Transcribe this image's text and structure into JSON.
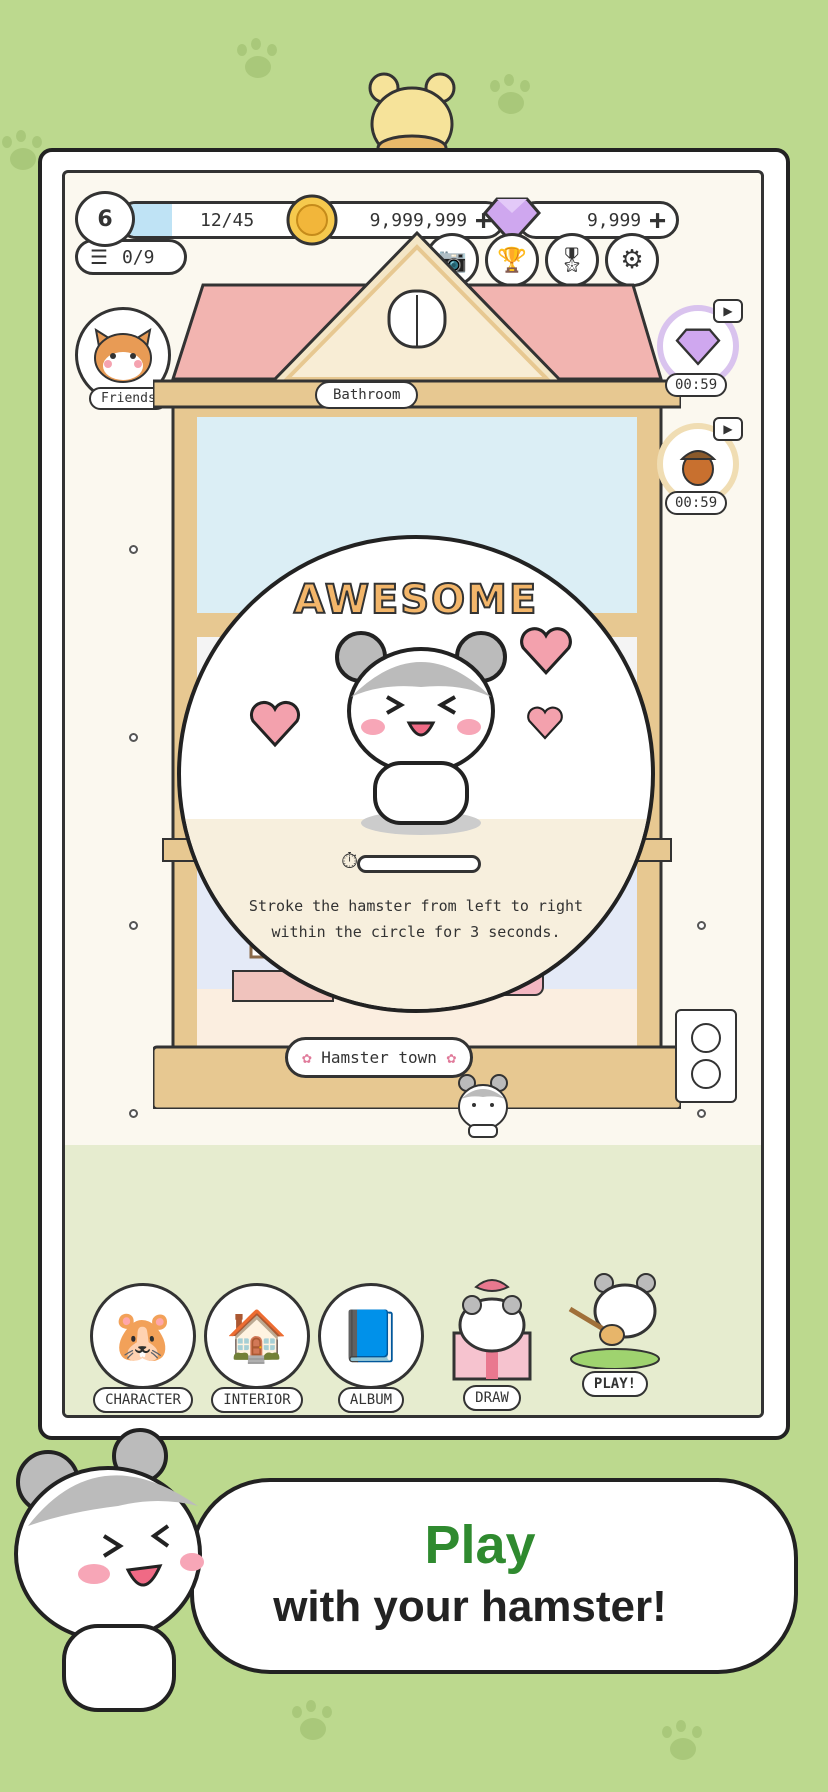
{
  "header": {
    "level": "6",
    "xp": "12/45",
    "xp_progress": 0.27,
    "coins": "9,999,999",
    "gems": "9,999",
    "quests": "0/9"
  },
  "icons": {
    "camera": "camera-icon",
    "trophy": "trophy-icon",
    "badge": "badge-icon",
    "settings": "gear-icon"
  },
  "friends_label": "Friends",
  "room_label": "Bathroom",
  "rewards": [
    {
      "timer": "00:59",
      "item": "gem"
    },
    {
      "timer": "00:59",
      "item": "acorn"
    }
  ],
  "popup": {
    "title": "AWESOME",
    "instruction_line1": "Stroke the hamster from left to right",
    "instruction_line2": "within the circle for 3 seconds."
  },
  "town_label": "Hamster town",
  "bottom_nav": [
    {
      "label": "CHARACTER"
    },
    {
      "label": "INTERIOR"
    },
    {
      "label": "ALBUM"
    },
    {
      "label": "DRAW"
    },
    {
      "label": "PLAY!"
    }
  ],
  "promo": {
    "line1": "Play",
    "line2": "with your hamster!"
  },
  "colors": {
    "background": "#bcd98e",
    "roof": "#f2b4b0",
    "wood": "#e7c891",
    "accent_green": "#2f8a2f",
    "xp_bar": "#bfe3f5"
  }
}
